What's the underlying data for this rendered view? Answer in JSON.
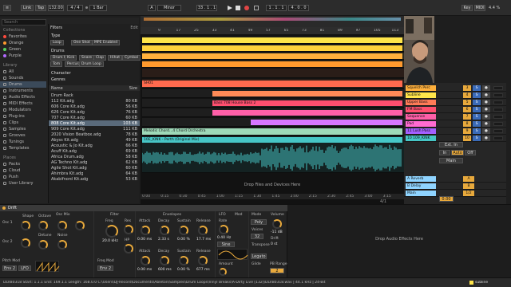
{
  "topbar": {
    "link": "Link",
    "tap": "Tap",
    "tempo": "132.00",
    "sig": "4 / 4",
    "quant": "1 Bar",
    "key": "A",
    "scale": "Minor",
    "pos": "33 . 1 . 1",
    "pos2": "1 . 1 . 1",
    "len": "4 . 0 . 0",
    "keylabel": "Key",
    "midi": "MIDI",
    "cpu": "4.4 %"
  },
  "browser": {
    "search_placeholder": "Search",
    "filters_label": "Filters",
    "edit_label": "Edit",
    "collections_header": "Collections",
    "collections": [
      {
        "label": "Favorites",
        "color": "#ff4a3d"
      },
      {
        "label": "Orange",
        "color": "#ff9a2e"
      },
      {
        "label": "Green",
        "color": "#57d35f"
      },
      {
        "label": "Purple",
        "color": "#b26bff"
      }
    ],
    "library_header": "Library",
    "library": [
      "All",
      "Sounds",
      "Drums",
      "Instruments",
      "Audio Effects",
      "MIDI Effects",
      "Modulators",
      "Plug-ins",
      "Clips",
      "Samples",
      "Grooves",
      "Tunings",
      "Templates"
    ],
    "places_header": "Places",
    "places": [
      "Packs",
      "Cloud",
      "Push",
      "User Library"
    ],
    "type_label": "Type",
    "type_chips": [
      "Loop",
      "One Shot",
      "MPE Enabled"
    ],
    "drums_label": "Drums",
    "drums_chips": [
      "Drum Kit",
      "Kick",
      "Snare",
      "Clap",
      "Hihat",
      "Cymbal",
      "Tom",
      "Percussion",
      "Drum Loop"
    ],
    "character_label": "Character",
    "genres_label": "Genres",
    "col_name": "Name",
    "col_size": "Size",
    "files": [
      {
        "name": "Drum Rack",
        "size": ""
      },
      {
        "name": "112 Kit.adg",
        "size": "80 KB"
      },
      {
        "name": "606 Core Kit.adg",
        "size": "56 KB"
      },
      {
        "name": "626 Core Kit.adg",
        "size": "76 KB"
      },
      {
        "name": "707 Core Kit.adg",
        "size": "60 KB"
      },
      {
        "name": "808 Core Kit.adg",
        "size": "103 KB"
      },
      {
        "name": "909 Core Kit.adg",
        "size": "111 KB"
      },
      {
        "name": "2020 Vision Beatbox.adg",
        "size": "78 KB"
      },
      {
        "name": "Abyss Kit.adg",
        "size": "49 KB"
      },
      {
        "name": "Acoustic & Jo Kit.adg",
        "size": "66 KB"
      },
      {
        "name": "Acuff Kit.adg",
        "size": "69 KB"
      },
      {
        "name": "Africa Drum.adg",
        "size": "58 KB"
      },
      {
        "name": "AG Techno Kit.adg",
        "size": "62 KB"
      },
      {
        "name": "Agile Shot Kit.adg",
        "size": "60 KB"
      },
      {
        "name": "Ahimbra Kit.adg",
        "size": "64 KB"
      },
      {
        "name": "Akabifnord Kit.adg",
        "size": "53 KB"
      }
    ]
  },
  "arrangement": {
    "ruler": [
      "9",
      "17",
      "25",
      "33",
      "41",
      "49",
      "57",
      "65",
      "73",
      "81",
      "89",
      "97",
      "105",
      "113"
    ],
    "times": [
      "0:00",
      "0:15",
      "0:30",
      "0:45",
      "1:00",
      "1:15",
      "1:30",
      "1:45",
      "2:00",
      "2:15",
      "2:30",
      "2:45",
      "3:00",
      "3:15"
    ],
    "clip_sh01": "SH01",
    "clip_bass": "Bass 708 House Bass 2",
    "clip_lead": "Melodic Chord...4 Chord Orchestra",
    "clip_audio": "10E_KINK - Perth (Original Mix)",
    "drop_label": "Drop Files and Devices Here",
    "page": "4/1"
  },
  "mixer": {
    "tracks": [
      {
        "name": "Squelch Perc",
        "color": "#ffb03c",
        "num": "3"
      },
      {
        "name": "Subline",
        "color": "#ffe54a",
        "num": "4"
      },
      {
        "name": "Upper Bass",
        "color": "#ff7b57",
        "num": "5"
      },
      {
        "name": "FM Bass",
        "color": "#ff4f6f",
        "num": "6"
      },
      {
        "name": "Sequence",
        "color": "#ff5fa8",
        "num": "7"
      },
      {
        "name": "Pad",
        "color": "#ff6bd1",
        "num": "8"
      },
      {
        "name": "11 Lush Pass",
        "color": "#a45fff",
        "num": "9"
      },
      {
        "name": "10 109_KINK",
        "color": "#46c6c6",
        "num": "10"
      }
    ],
    "ext_in": "Ext. In",
    "auto": "Auto",
    "off": "Off",
    "master": "Main",
    "returns": [
      {
        "name": "A Reverb",
        "color": "#8fd4ff",
        "num": "A"
      },
      {
        "name": "B Delay",
        "color": "#8fd4ff",
        "num": "B"
      },
      {
        "name": "Main",
        "color": "#8fd4ff",
        "num": "1/2"
      }
    ],
    "cue": "0.00"
  },
  "device": {
    "title": "Drift",
    "osc_header": "Osc Mix",
    "filter_header": "Filter",
    "env_header": "Envelopes",
    "lfo_header": "LFO",
    "mod_header": "Mod",
    "mode_header": "Mode",
    "volume_header": "Volume",
    "osc1": "Osc 1",
    "osc2": "Osc 2",
    "shape": "Shape",
    "octave": "Octave",
    "detune": "Detune",
    "noise": "Noise",
    "freq_label": "Freq",
    "freq_val": "20.0 kHz",
    "res": "Res",
    "hp": "HP",
    "freq_mod": "Freq Mod",
    "attack": "Attack",
    "decay": "Decay",
    "sustain": "Sustain",
    "release": "Release",
    "a_val": "0.00 ms",
    "d_val": "2.33 s",
    "s_val": "0.00 %",
    "r_val": "17.7 ms",
    "a2_val": "0.00 ms",
    "d2_val": "600 ms",
    "s2_val": "0.00 %",
    "r2_val": "677 ms",
    "rate": "Rate",
    "rate_val": "0.40 Hz",
    "amount": "Amount",
    "lfo_shape": "Sine",
    "poly": "Poly",
    "voices": "Voices",
    "voices_val": "32",
    "drift": "Drift",
    "drift_val": "0 st",
    "transpose": "Transpose",
    "legato": "Legato",
    "glide": "Glide",
    "pb_range": "PB Range",
    "volume_val": "-11 dB",
    "pitch_mod": "Pitch Mod",
    "env2": "Env 2",
    "lfo": "LFO",
    "drop_fx": "Drop Audio Effects Here"
  },
  "status": {
    "text": "DLVB0318  Start: 1.1.1  End: 169.1.1  Length: 168.0.0  C:\\Users\\DJ-Record\\Documents\\Ableton\\Samples\\Drum Loops\\Vinyl Breaks\\A-Dirty Live [132]\\DLVB0318.wav | 44.1 kHz | 24-Bit",
    "right": "subline"
  }
}
